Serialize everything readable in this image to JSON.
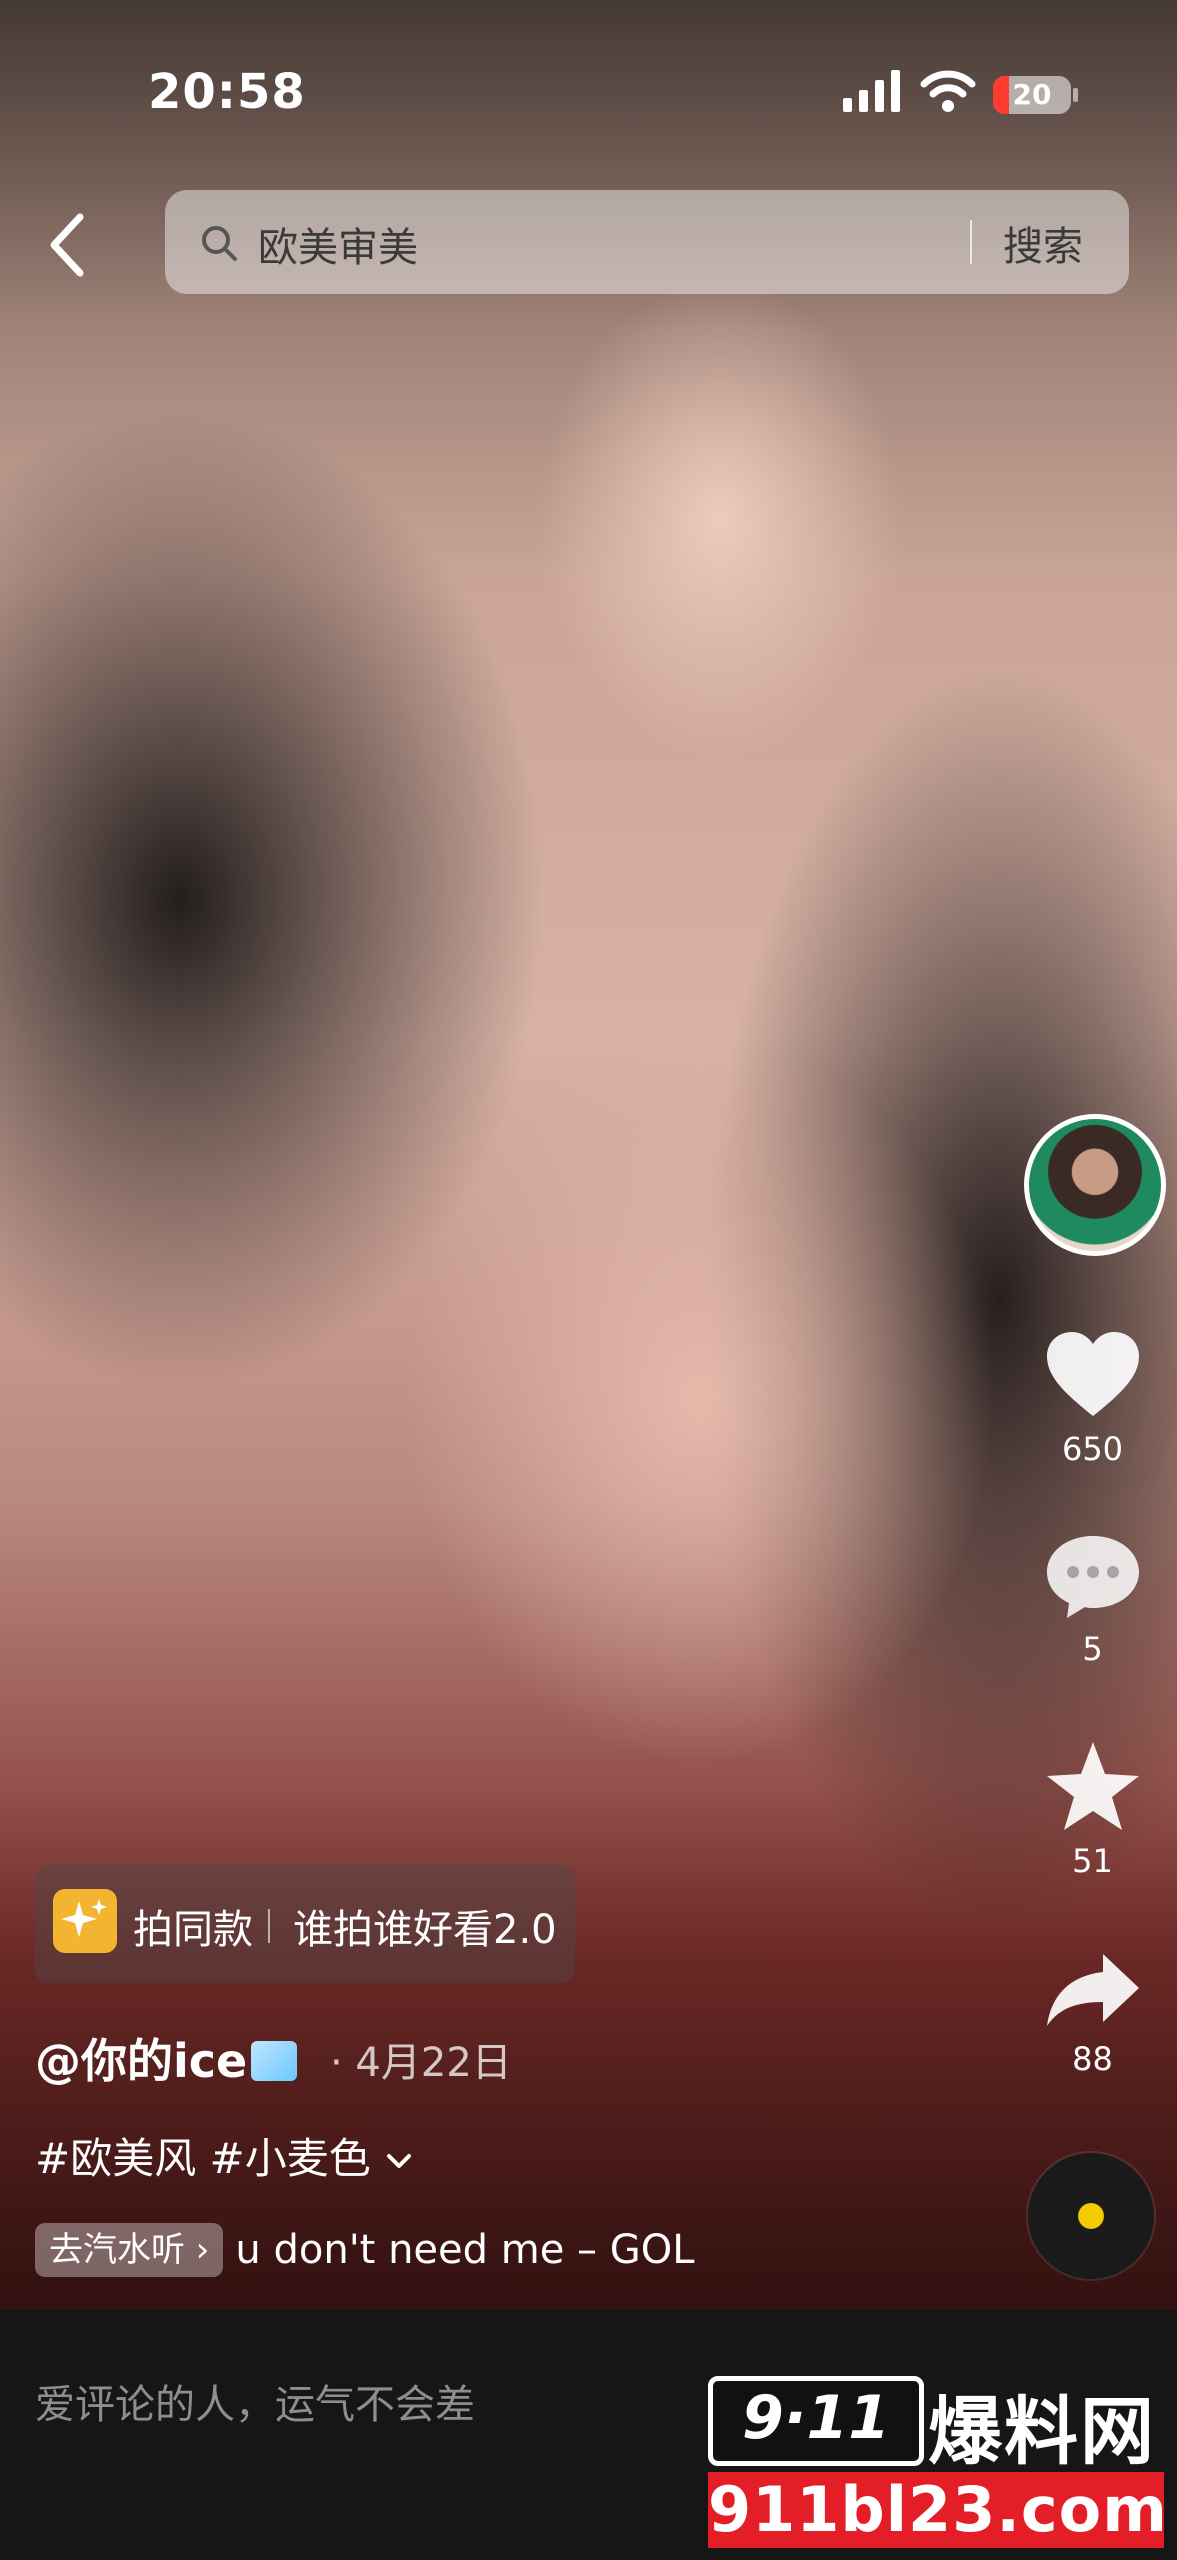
{
  "status_bar": {
    "time": "20:58",
    "battery_text": "20",
    "battery_level_percent": 20
  },
  "search": {
    "query": "欧美审美",
    "button_label": "搜索"
  },
  "rail": {
    "likes": "650",
    "comments": "5",
    "favorites": "51",
    "shares": "88"
  },
  "template": {
    "label": "拍同款",
    "name": "谁拍谁好看2.0"
  },
  "post": {
    "author": "@你的ice",
    "date": "· 4月22日",
    "hashtags": "#欧美风 #小麦色",
    "music_tag": "去汽水听 ›",
    "music_title": "u don't need me – GOL"
  },
  "comment_bar": {
    "placeholder": "爱评论的人，运气不会差"
  },
  "watermark": {
    "box_text": "9·11",
    "brand": "爆料网",
    "url": "911bl23.com"
  },
  "icons": {
    "back": "chevron-left-icon",
    "search": "search-icon",
    "like": "heart-icon",
    "comment": "comment-bubble-icon",
    "favorite": "star-icon",
    "share": "share-arrow-icon",
    "template": "sparkle-icon",
    "more": "chevron-down-icon"
  },
  "colors": {
    "battery_low": "#ff3b30",
    "music_disc_center": "#f5cc00",
    "watermark_red": "#e41e26"
  }
}
